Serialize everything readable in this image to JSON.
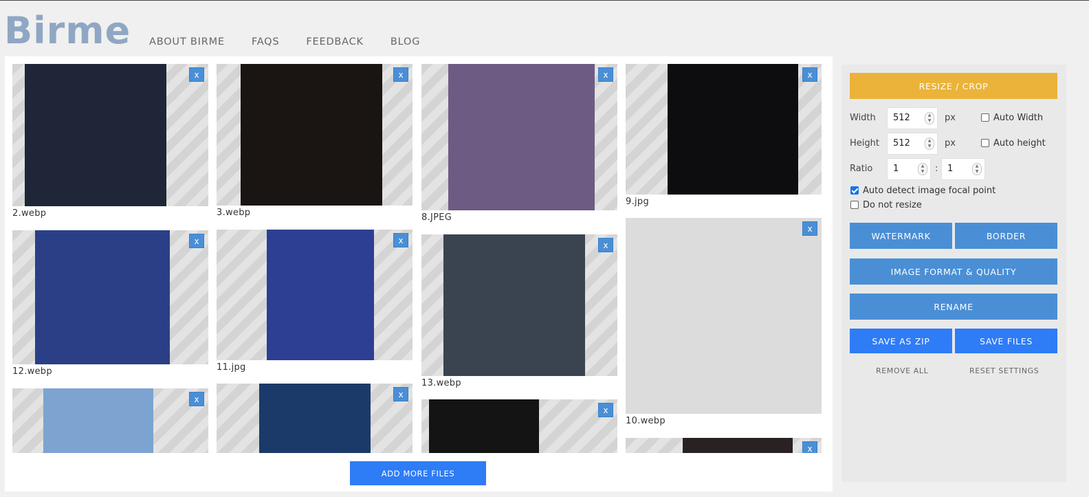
{
  "brand": {
    "logo": "Birme"
  },
  "nav": [
    "ABOUT BIRME",
    "FAQS",
    "FEEDBACK",
    "BLOG"
  ],
  "remove_label": "x",
  "columns": [
    [
      {
        "name": "2.webp",
        "bg": "#cdd2d8",
        "photo": "#1e2638"
      },
      {
        "name": "12.webp",
        "bg": "#d8dde6",
        "photo": "#2a3f86"
      },
      {
        "name": "",
        "bg": "#e0e4ea",
        "photo": "#7da3d1"
      }
    ],
    [
      {
        "name": "3.webp",
        "bg": "#cfcfcf",
        "photo": "#1a1412"
      },
      {
        "name": "11.jpg",
        "bg": "#d6dae3",
        "photo": "#2c3f93"
      },
      {
        "name": "",
        "bg": "#d8dde6",
        "photo": "#1b3a6a"
      }
    ],
    [
      {
        "name": "8.JPEG",
        "bg": "#d9dde5",
        "photo": "#6e5b84"
      },
      {
        "name": "13.webp",
        "bg": "#d9d9d9",
        "photo": "#3a4350"
      },
      {
        "name": "",
        "bg": "#d5d5d5",
        "photo": "#141414"
      }
    ],
    [
      {
        "name": "9.jpg",
        "bg": "#d2d2d2",
        "photo": "#0d0d10"
      },
      {
        "name": "10.webp",
        "bg": "#e2e2e2",
        "photo": "#dcdcdc"
      },
      {
        "name": "",
        "bg": "#d8d8d8",
        "photo": "#2a2222"
      }
    ]
  ],
  "add_more": "ADD MORE FILES",
  "panel": {
    "resize_button": "RESIZE / CROP",
    "width_label": "Width",
    "width_value": "512",
    "height_label": "Height",
    "height_value": "512",
    "unit": "px",
    "auto_width": "Auto Width",
    "auto_height": "Auto height",
    "ratio_label": "Ratio",
    "ratio_w": "1",
    "ratio_sep": ":",
    "ratio_h": "1",
    "focal_point": "Auto detect image focal point",
    "do_not_resize": "Do not resize",
    "watermark": "WATERMARK",
    "border": "BORDER",
    "format_quality": "IMAGE FORMAT & QUALITY",
    "rename": "RENAME",
    "save_zip": "SAVE AS ZIP",
    "save_files": "SAVE FILES",
    "remove_all": "REMOVE ALL",
    "reset_settings": "RESET SETTINGS"
  },
  "colors": {
    "accent": "#4a8fd6",
    "primary": "#2e7cf6",
    "resize": "#ebb33a",
    "logo": "#8fa7c4"
  }
}
